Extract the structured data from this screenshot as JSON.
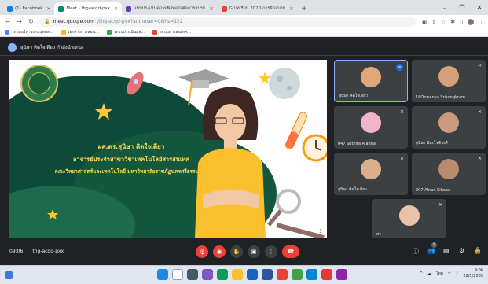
{
  "browser": {
    "tabs": [
      {
        "label": "(1) Facebook",
        "color": "#1877f2",
        "active": false
      },
      {
        "label": "Meet - thg-acqd-pxx",
        "color": "#00897b",
        "active": true
      },
      {
        "label": "แบบประเมินความพึงพอใจต่อการอบรม",
        "color": "#673ab7",
        "active": false
      },
      {
        "label": "G บทเรียน 2020 การฝึกอบรม",
        "color": "#ea4335",
        "active": false
      }
    ],
    "new_tab": "+",
    "window_controls": {
      "minimize": "⌄",
      "restore": "❐",
      "close": "✕"
    },
    "url_host": "meet.google.com",
    "url_path": "/thg-acqd-pxx?authuser=0&hs=122",
    "bookmarks": [
      {
        "label": "ระบบบริหารงานบุคคล...",
        "color": "#4285f4"
      },
      {
        "label": "เอกสารการสอน...",
        "color": "#fbbc05"
      },
      {
        "label": "ระบบประเมินผล...",
        "color": "#34a853"
      },
      {
        "label": "ระบบสารสนเทศ...",
        "color": "#ea4335"
      }
    ]
  },
  "meet": {
    "presenter_label": "สุนิษา คิดใจเดียว กำลังนำเสนอ",
    "slide": {
      "line1": "ผศ.ดร.สุนิษา คิดใจเดียว",
      "line2": "อาจารย์ประจำสาขาวิชาเทคโนโลยีสารสนเทศ",
      "line3": "คณะวิทยาศาสตร์และเทคโนโลยี มหาวิทยาลัยราชภัฏนครศรีธรรมราช",
      "page_number": "1"
    },
    "participants": [
      {
        "name": "สุนิษา คิดใจเดียว",
        "face": "#e0a878",
        "mic": "speaking"
      },
      {
        "name": "18Onwanya Srisongkram",
        "face": "#d4a17a",
        "mic": "muted"
      },
      {
        "name": "047 Suthita Aladhai",
        "face": "#f0b5c8",
        "mic": "muted"
      },
      {
        "name": "สุนิษา ปิยะโชติวงศ์",
        "face": "#c99a7c",
        "mic": "muted"
      },
      {
        "name": "สุนิษา คิดใจเดียว",
        "face": "#d9b08c",
        "mic": "muted"
      },
      {
        "name": "207 Afnan Siheae",
        "face": "#b98a6c",
        "mic": "muted"
      },
      {
        "name": "ศร",
        "face": "#e8c3a8",
        "mic": "muted"
      }
    ],
    "time": "09:06",
    "separator": "|",
    "meeting_code": "thg-acqd-pxx",
    "people_count": "8",
    "controls": {
      "mic": "🎙",
      "camera": "◉",
      "raise_hand": "✋",
      "present": "▣",
      "more": "⋮",
      "end_call": "☎"
    },
    "right_controls": {
      "info": "ⓘ",
      "people": "👥",
      "chat": "▤",
      "activities": "⚙",
      "lock": "🔒"
    }
  },
  "taskbar": {
    "clock_time": "9:06",
    "clock_date": "22/5/2565",
    "lang": "ไทย",
    "tray_arrow": "^"
  }
}
